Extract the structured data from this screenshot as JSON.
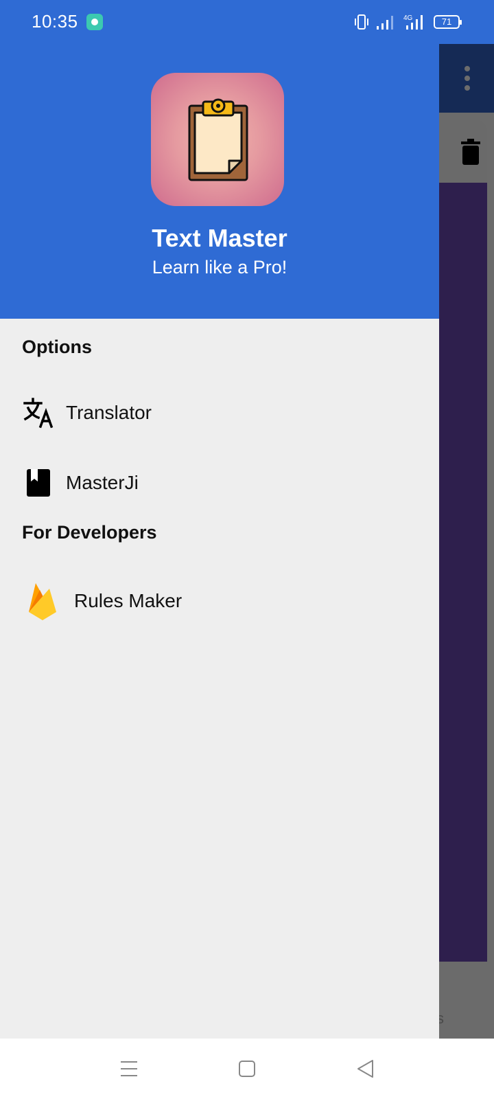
{
  "status_bar": {
    "time": "10:35",
    "battery": "71",
    "network": "4G",
    "icons": [
      "notification-app-icon",
      "vibrate-icon",
      "signal-icon",
      "signal-4g-icon",
      "battery-icon"
    ]
  },
  "drawer": {
    "header": {
      "app_name": "Text Master",
      "tagline": "Learn like a Pro!",
      "logo_icon": "clipboard-icon"
    },
    "sections": [
      {
        "title": "Options",
        "items": [
          {
            "label": "Translator",
            "icon": "translate-icon"
          },
          {
            "label": "MasterJi",
            "icon": "book-icon"
          }
        ]
      },
      {
        "title": "For Developers",
        "items": [
          {
            "label": "Rules Maker",
            "icon": "firebase-icon"
          }
        ]
      }
    ]
  },
  "background_app": {
    "bottom_text_fragment": "s",
    "icons": [
      "more-vert-icon",
      "delete-icon"
    ]
  },
  "nav_bar": {
    "icons": [
      "menu-icon",
      "home-icon",
      "back-icon"
    ]
  },
  "colors": {
    "header_blue": "#2f6bd4",
    "drawer_bg": "#eeeeee",
    "bg_content": "#2e1f4d",
    "bg_toolbar": "#152a55"
  }
}
